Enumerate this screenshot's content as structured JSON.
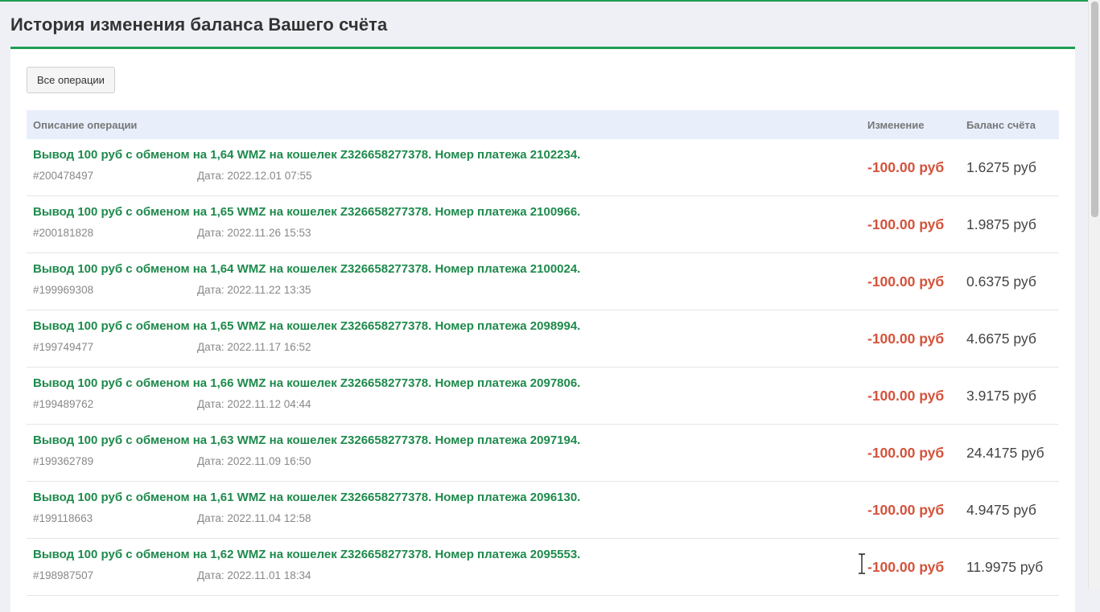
{
  "page": {
    "title": "История изменения баланса Вашего счёта"
  },
  "filter": {
    "all_operations_label": "Все операции"
  },
  "table": {
    "columns": {
      "description": "Описание операции",
      "change": "Изменение",
      "balance": "Баланс счёта"
    },
    "rows": [
      {
        "description": "Вывод 100 руб с обменом на 1,64 WMZ на кошелек Z326658277378. Номер платежа 2102234.",
        "id": "#200478497",
        "date": "Дата: 2022.12.01 07:55",
        "change": "-100.00 руб",
        "balance": "1.6275 руб"
      },
      {
        "description": "Вывод 100 руб с обменом на 1,65 WMZ на кошелек Z326658277378. Номер платежа 2100966.",
        "id": "#200181828",
        "date": "Дата: 2022.11.26 15:53",
        "change": "-100.00 руб",
        "balance": "1.9875 руб"
      },
      {
        "description": "Вывод 100 руб с обменом на 1,64 WMZ на кошелек Z326658277378. Номер платежа 2100024.",
        "id": "#199969308",
        "date": "Дата: 2022.11.22 13:35",
        "change": "-100.00 руб",
        "balance": "0.6375 руб"
      },
      {
        "description": "Вывод 100 руб с обменом на 1,65 WMZ на кошелек Z326658277378. Номер платежа 2098994.",
        "id": "#199749477",
        "date": "Дата: 2022.11.17 16:52",
        "change": "-100.00 руб",
        "balance": "4.6675 руб"
      },
      {
        "description": "Вывод 100 руб с обменом на 1,66 WMZ на кошелек Z326658277378. Номер платежа 2097806.",
        "id": "#199489762",
        "date": "Дата: 2022.11.12 04:44",
        "change": "-100.00 руб",
        "balance": "3.9175 руб"
      },
      {
        "description": "Вывод 100 руб с обменом на 1,63 WMZ на кошелек Z326658277378. Номер платежа 2097194.",
        "id": "#199362789",
        "date": "Дата: 2022.11.09 16:50",
        "change": "-100.00 руб",
        "balance": "24.4175 руб"
      },
      {
        "description": "Вывод 100 руб с обменом на 1,61 WMZ на кошелек Z326658277378. Номер платежа 2096130.",
        "id": "#199118663",
        "date": "Дата: 2022.11.04 12:58",
        "change": "-100.00 руб",
        "balance": "4.9475 руб"
      },
      {
        "description": "Вывод 100 руб с обменом на 1,62 WMZ на кошелек Z326658277378. Номер платежа 2095553.",
        "id": "#198987507",
        "date": "Дата: 2022.11.01 18:34",
        "change": "-100.00 руб",
        "balance": "11.9975 руб"
      }
    ]
  },
  "colors": {
    "accent_green": "#1f9d55",
    "description_green": "#1e8a4c",
    "negative_red": "#d4533b",
    "header_bg": "#e8effb"
  },
  "icons": {
    "cursor": "text-cursor-icon"
  }
}
